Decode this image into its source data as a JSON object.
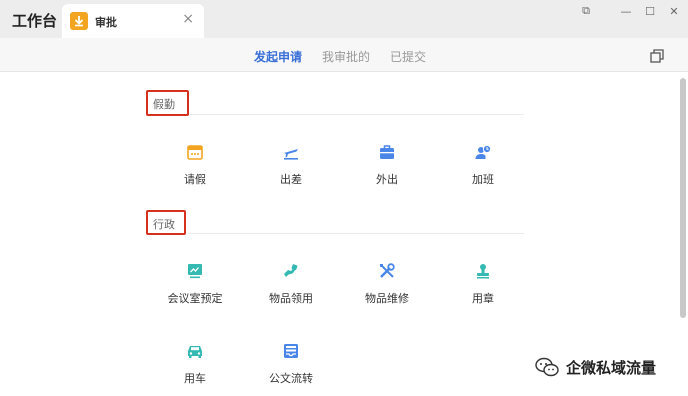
{
  "app": {
    "title": "工作台"
  },
  "tab": {
    "label": "审批",
    "close": "×"
  },
  "window_controls": [
    "⧉",
    "—",
    "☐",
    "✕"
  ],
  "subnav": {
    "tabs": [
      "发起申请",
      "我审批的",
      "已提交"
    ],
    "active_index": 0
  },
  "sections": [
    {
      "title": "假勤",
      "items": [
        {
          "label": "请假",
          "icon": "calendar-icon"
        },
        {
          "label": "出差",
          "icon": "airplane-icon"
        },
        {
          "label": "外出",
          "icon": "briefcase-icon"
        },
        {
          "label": "加班",
          "icon": "person-clock-icon"
        }
      ]
    },
    {
      "title": "行政",
      "items": [
        {
          "label": "会议室预定",
          "icon": "meeting-screen-icon"
        },
        {
          "label": "物品领用",
          "icon": "hand-receive-icon"
        },
        {
          "label": "物品维修",
          "icon": "tools-icon"
        },
        {
          "label": "用章",
          "icon": "stamp-icon"
        },
        {
          "label": "用车",
          "icon": "car-icon"
        },
        {
          "label": "公文流转",
          "icon": "inbox-icon"
        }
      ]
    }
  ],
  "watermark": {
    "text": "企微私域流量"
  },
  "colors": {
    "accent": "#3a6fd8",
    "icon_orange": "#f3a521",
    "icon_blue": "#4a86e8",
    "icon_teal": "#34b9b3",
    "highlight_red": "#d6301f"
  }
}
